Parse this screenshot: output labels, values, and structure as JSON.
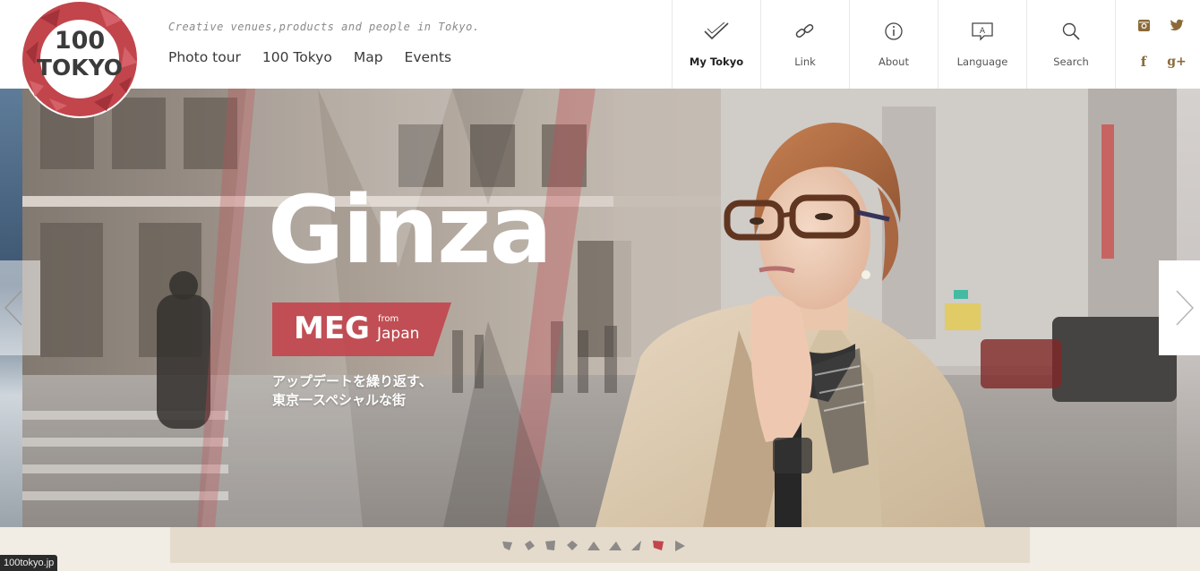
{
  "brand": {
    "logo_line1": "100",
    "logo_line2": "TOKYO",
    "tagline": "Creative venues,products and people in Tokyo.",
    "accent": "#c2454c"
  },
  "main_nav": [
    {
      "label": "Photo tour"
    },
    {
      "label": "100 Tokyo"
    },
    {
      "label": "Map"
    },
    {
      "label": "Events"
    }
  ],
  "tool_nav": [
    {
      "label": "My Tokyo",
      "icon": "check-icon",
      "active": true
    },
    {
      "label": "Link",
      "icon": "link-icon"
    },
    {
      "label": "About",
      "icon": "info-icon"
    },
    {
      "label": "Language",
      "icon": "language-icon"
    },
    {
      "label": "Search",
      "icon": "search-icon"
    }
  ],
  "social": [
    {
      "icon": "instagram-icon"
    },
    {
      "icon": "twitter-icon"
    },
    {
      "icon": "facebook-icon"
    },
    {
      "icon": "google-plus-icon"
    }
  ],
  "hero": {
    "title": "Ginza",
    "person_name": "MEG",
    "from_label": "from",
    "country": "Japan",
    "subtitle_line1": "アップデートを繰り返す、",
    "subtitle_line2": "東京一スペシャルな街"
  },
  "pager": {
    "slide_count": 10,
    "active_index": 8
  },
  "status_bar": {
    "url": "100tokyo.jp"
  }
}
